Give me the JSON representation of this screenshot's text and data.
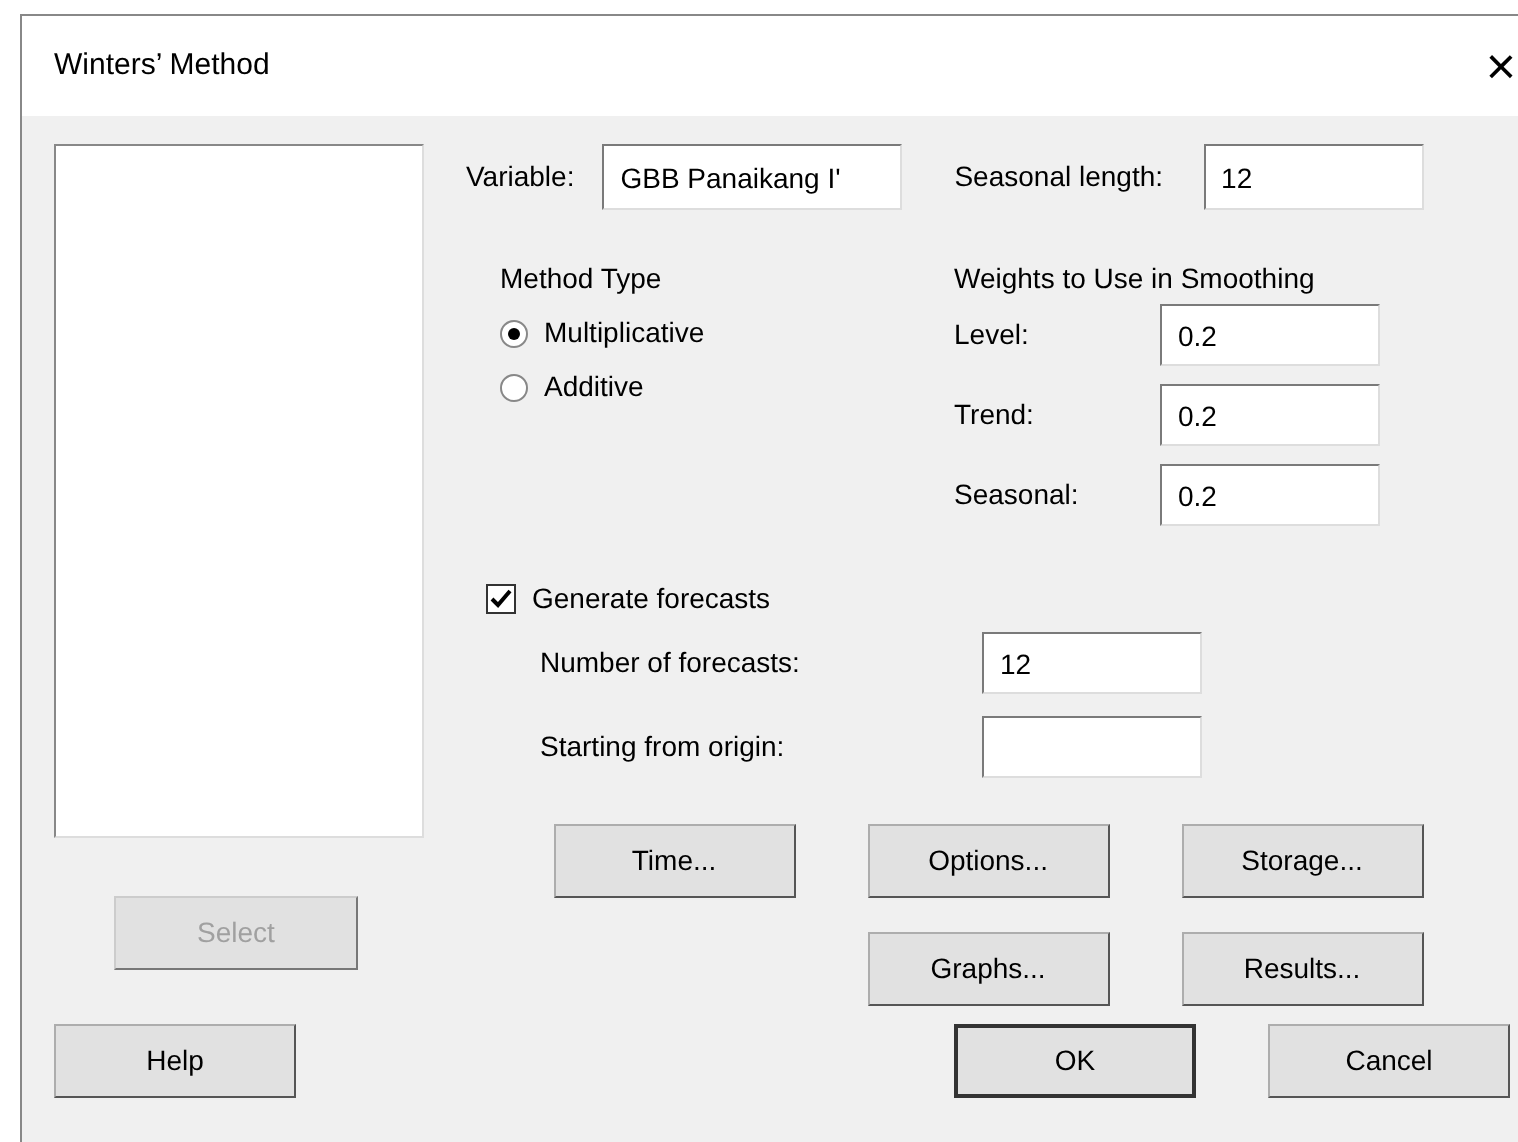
{
  "window": {
    "title": "Winters’ Method",
    "close": "×"
  },
  "variable": {
    "label": "Variable:",
    "value": "GBB Panaikang I'"
  },
  "seasonal_length": {
    "label": "Seasonal length:",
    "value": "12"
  },
  "method_type": {
    "label": "Method Type",
    "options": [
      {
        "label": "Multiplicative",
        "selected": true
      },
      {
        "label": "Additive",
        "selected": false
      }
    ]
  },
  "weights": {
    "label": "Weights to Use in Smoothing",
    "fields": [
      {
        "label": "Level:",
        "value": "0.2"
      },
      {
        "label": "Trend:",
        "value": "0.2"
      },
      {
        "label": "Seasonal:",
        "value": "0.2"
      }
    ]
  },
  "generate_forecasts": {
    "label": "Generate forecasts",
    "checked": true
  },
  "number_of_forecasts": {
    "label": "Number of forecasts:",
    "value": "12"
  },
  "starting_from_origin": {
    "label": "Starting from origin:"
  },
  "select_button": {
    "label": "Select",
    "disabled": true
  },
  "buttons": [
    [
      "Time...",
      "Options...",
      "Storage..."
    ],
    [
      "Graphs...",
      "Results..."
    ]
  ],
  "footer_buttons": [
    {
      "label": "Help",
      "default": false
    },
    {
      "label": "OK",
      "default": true
    },
    {
      "label": "Cancel",
      "default": false
    }
  ]
}
